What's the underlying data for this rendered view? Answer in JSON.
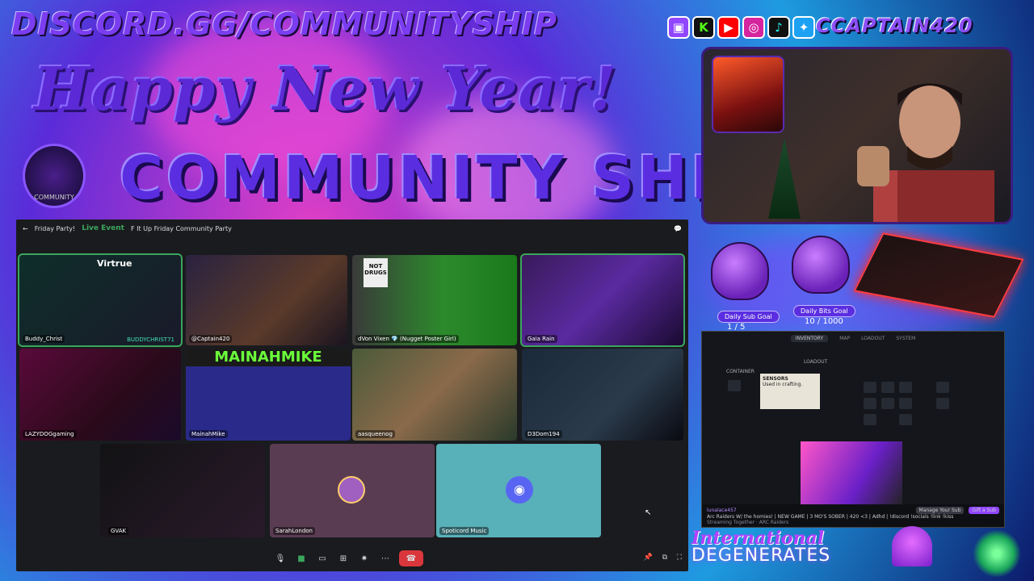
{
  "header": {
    "discord_url": "DISCORD.GG/COMMUNITYSHIP",
    "social_handle": "CCAPTAIN420",
    "greeting": "Happy New Year!",
    "brand": "COMMUNITY SHIP",
    "logo_text": "COMMUNITY"
  },
  "social_icons": [
    "twitch-icon",
    "kick-icon",
    "youtube-icon",
    "instagram-icon",
    "tiktok-icon",
    "twitter-icon"
  ],
  "discord": {
    "server": "Friday Party!",
    "live_label": "Live Event",
    "event_name": "F It Up Friday Community Party",
    "participants": [
      {
        "name": "Buddy_Christ",
        "overlay": "Virtrue",
        "banner": "BUDDYCHRIST71"
      },
      {
        "name": "@Captain420"
      },
      {
        "name": "dVon Vixen 💎 (Nugget Poster Girl)",
        "sign": "NOT DRUGS"
      },
      {
        "name": "Gaia Rain"
      },
      {
        "name": "LAZYDOGgaming"
      },
      {
        "name": "MainahMike",
        "banner": "MAINAHMIKE"
      },
      {
        "name": "aasqueenog"
      },
      {
        "name": "D3Dom194"
      },
      {
        "name": "GVAK"
      },
      {
        "name": "SarahLondon"
      },
      {
        "name": "Spoticord Music"
      }
    ]
  },
  "goals": [
    {
      "label": "Daily Sub Goal",
      "count": "1 / 5"
    },
    {
      "label": "Daily Bits Goal",
      "count": "10 / 1000"
    }
  ],
  "game": {
    "tabs": [
      "INVENTORY",
      "MAP",
      "LOADOUT",
      "SYSTEM"
    ],
    "container_label": "CONTAINER",
    "loadout_label": "LOADOUT",
    "tooltip_title": "SENSORS",
    "tooltip_text": "Used in crafting.",
    "stream_title": "Arc Raiders W/ the homies! | NEW GAME | 3 MO'S SOBER | 420 <3 | Adhd | !discord !socials !link !kiss",
    "streamer": "lunalace457",
    "stream_sub": "Streaming Together · ARC Raiders",
    "manage_sub": "Manage Your Sub",
    "gift_sub": "Gift a Sub"
  },
  "footer": {
    "international": "International",
    "degenerates": "DEGENERATES"
  }
}
